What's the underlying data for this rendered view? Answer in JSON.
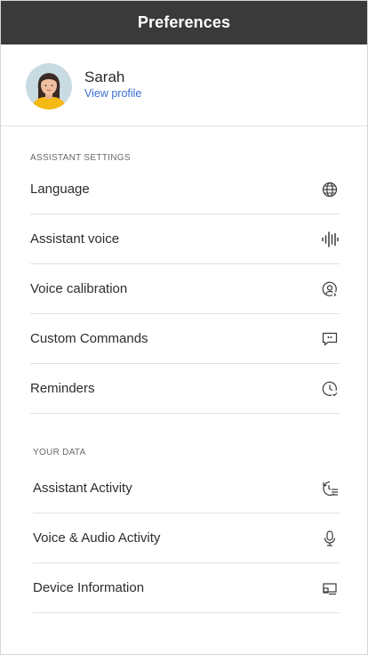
{
  "header": {
    "title": "Preferences"
  },
  "profile": {
    "name": "Sarah",
    "link_label": "View profile"
  },
  "assistant_settings": {
    "heading": "ASSISTANT SETTINGS",
    "items": [
      {
        "label": "Language",
        "icon": "globe-icon"
      },
      {
        "label": "Assistant voice",
        "icon": "voice-waveform-icon"
      },
      {
        "label": "Voice calibration",
        "icon": "voice-calibration-icon"
      },
      {
        "label": "Custom Commands",
        "icon": "chat-bubble-icon"
      },
      {
        "label": "Reminders",
        "icon": "clock-icon"
      }
    ]
  },
  "your_data": {
    "heading": "YOUR DATA",
    "items": [
      {
        "label": "Assistant Activity",
        "icon": "history-list-icon"
      },
      {
        "label": "Voice & Audio Activity",
        "icon": "microphone-icon"
      },
      {
        "label": "Device Information",
        "icon": "device-icon"
      }
    ]
  },
  "colors": {
    "titlebar": "#3a3a3a",
    "link": "#3b6fd1",
    "divider": "#e0e0e0",
    "avatar_bg": "#c9dbe2",
    "avatar_shirt": "#f5b914"
  }
}
